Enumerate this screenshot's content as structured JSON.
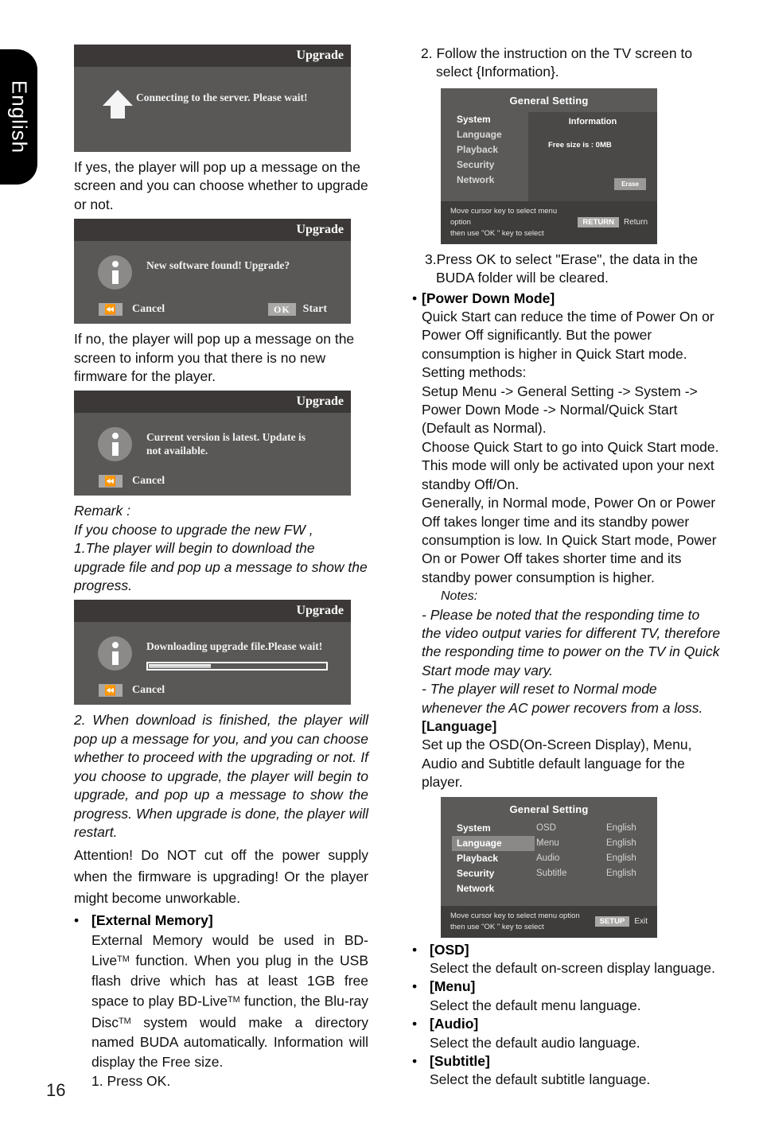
{
  "page": {
    "language_tab": "English",
    "page_number": "16"
  },
  "left_column": {
    "dialog_connecting": {
      "title": "Upgrade",
      "message": "Connecting to the server. Please wait!",
      "icon": "up-arrow-icon"
    },
    "para_if_yes": "If yes, the player will pop up a message on the screen and you can choose whether to upgrade or not.",
    "dialog_new_software": {
      "title": "Upgrade",
      "message": "New software found! Upgrade?",
      "cancel_label": "Cancel",
      "ok_key": "OK",
      "ok_label": "Start"
    },
    "para_if_no": "If no, the player will pop up a message on the screen to inform you that there is no new firmware for the player.",
    "dialog_latest": {
      "title": "Upgrade",
      "message": "Current version is latest. Update is not available.",
      "cancel_label": "Cancel"
    },
    "remark_heading": "Remark :",
    "remark_line1": "If you choose to upgrade the new FW ,",
    "remark_line2": "1.The player will begin to download the upgrade file and pop up a message to show the progress.",
    "dialog_downloading": {
      "title": "Upgrade",
      "message": "Downloading upgrade file.Please wait!",
      "cancel_label": "Cancel",
      "progress_percent": 35
    },
    "remark_step2": "2. When download is finished, the player will pop up a message for you, and you can choose whether to proceed with the upgrading or not. If you choose to upgrade, the player will begin to upgrade, and pop up a message to show the progress. When upgrade is done, the player will restart.",
    "attention": "Attention! Do NOT cut off the power supply when the firmware is upgrading! Or the player might become unworkable.",
    "external_memory": {
      "bullet": "•",
      "heading": "[External Memory]",
      "body_1": "External Memory would be used in BD-Live",
      "body_tm_1": "TM",
      "body_2": " function. When you plug in the USB flash drive which has at least 1GB free space to play BD-Live",
      "body_tm_2": "TM",
      "body_3": " function, the Blu-ray Disc",
      "body_tm_3": "TM",
      "body_4": " system would make a directory named BUDA automatically. Information will display the Free size.",
      "step_1": "1. Press OK."
    }
  },
  "right_column": {
    "step_2": "2. Follow the instruction on the TV screen to select {Information}.",
    "general_setting_information": {
      "title": "General Setting",
      "menu_items": [
        "System",
        "Language",
        "Playback",
        "Security",
        "Network"
      ],
      "active_item": "System",
      "panel_title": "Information",
      "free_size_text": "Free size is : 0MB",
      "erase_button": "Erase",
      "footer_line1": "Move cursor key to select menu option",
      "footer_line2": "then use \"OK \" key to select",
      "footer_key": "RETURN",
      "footer_key_label": "Return"
    },
    "step_3": "3.Press OK to select \"Erase\", the data in the BUDA folder will be cleared.",
    "power_down_mode": {
      "bullet": "•",
      "heading": "[Power Down Mode]",
      "para_1": "Quick Start can reduce the time of Power On or Power Off significantly. But the power consumption is higher in Quick Start mode.",
      "para_2": "Setting methods:",
      "para_3": "Setup Menu -> General Setting -> System -> Power Down Mode -> Normal/Quick Start (Default as Normal).",
      "para_4": "Choose Quick Start to go into Quick Start mode. This mode will only be activated upon your next standby Off/On.",
      "para_5": "Generally, in Normal mode, Power On or Power Off takes longer time and its standby power consumption is low. In Quick Start mode, Power On or Power Off takes shorter time and its standby power consumption is higher.",
      "notes_heading": "Notes:",
      "note_1": "- Please be noted that the responding time to the video output varies for different TV, therefore the responding time to power on the TV in Quick Start mode may vary.",
      "note_2": "- The player will reset to Normal mode whenever the AC power recovers from a loss."
    },
    "language_section": {
      "heading": "[Language]",
      "description": "Set up the OSD(On-Screen Display), Menu, Audio and Subtitle default language for the player."
    },
    "general_setting_language": {
      "title": "General Setting",
      "menu_items": [
        "System",
        "Language",
        "Playback",
        "Security",
        "Network"
      ],
      "highlighted_item": "Language",
      "rows": [
        {
          "key": "OSD",
          "value": "English"
        },
        {
          "key": "Menu",
          "value": "English"
        },
        {
          "key": "Audio",
          "value": "English"
        },
        {
          "key": "Subtitle",
          "value": "English"
        }
      ],
      "footer_line1": "Move cursor key to select menu option",
      "footer_line2": "then use \"OK \" key to select",
      "footer_key": "SETUP",
      "footer_key_label": "Exit"
    },
    "option_list": [
      {
        "bullet": "•",
        "heading": "[OSD]",
        "desc": "Select the default on-screen display language."
      },
      {
        "bullet": "•",
        "heading": "[Menu]",
        "desc": "Select the default menu language."
      },
      {
        "bullet": "•",
        "heading": "[Audio]",
        "desc": "Select the default audio language."
      },
      {
        "bullet": "•",
        "heading": "[Subtitle]",
        "desc": "Select the default subtitle language."
      }
    ]
  },
  "colors": {
    "osd_title_bar": "#3b3837",
    "osd_body": "#595857",
    "gs_body": "#5b5a59",
    "gs_panel": "#4a4948",
    "gs_footer": "#3f3d3c",
    "key_button": "#a9a8a7",
    "highlight": "#8a8988"
  }
}
